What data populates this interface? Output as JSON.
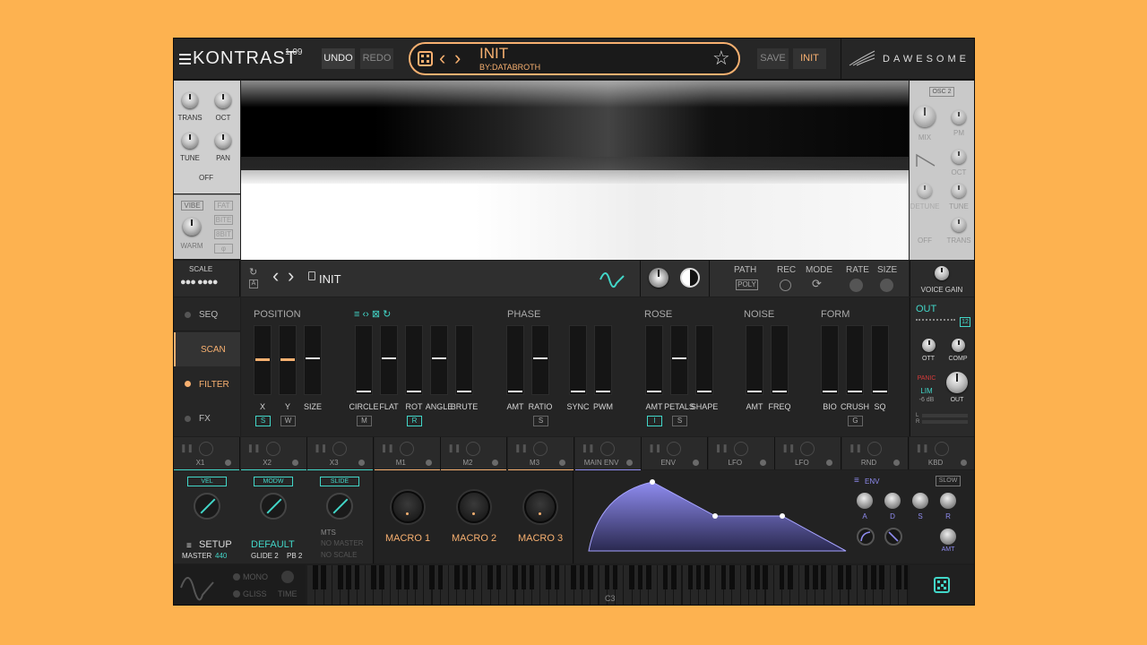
{
  "header": {
    "app_name": "KONTRAST",
    "version": "1.09",
    "undo": "UNDO",
    "redo": "REDO",
    "preset_name": "INIT",
    "preset_author": "BY:DATABROTH",
    "save": "SAVE",
    "init": "INIT",
    "brand": "DAWESOME"
  },
  "osc1": {
    "trans": "TRANS",
    "oct": "OCT",
    "tune": "TUNE",
    "pan": "PAN",
    "off": "OFF",
    "vibe": "VIBE",
    "fat": "FAT",
    "bite": "BITE",
    "bit8": "8BIT",
    "phi": "φ",
    "warm": "WARM"
  },
  "osc2": {
    "title": "OSC 2",
    "mix": "MIX",
    "pm": "PM",
    "oct": "OCT",
    "detune": "DETUNE",
    "tune": "TUNE",
    "off": "OFF",
    "trans": "TRANS"
  },
  "scale": {
    "label": "SCALE"
  },
  "wavebar": {
    "a_tag": "A",
    "table_name": "INIT",
    "path": "PATH",
    "poly": "POLY",
    "rec": "REC",
    "mode": "MODE",
    "rate": "RATE",
    "size": "SIZE",
    "voice_gain": "VOICE GAIN"
  },
  "side_tabs": [
    "SEQ",
    "SCAN",
    "FILTER",
    "FX"
  ],
  "sections": {
    "position": "POSITION",
    "phase": "PHASE",
    "rose": "ROSE",
    "noise": "NOISE",
    "form": "FORM"
  },
  "faders": {
    "position": [
      "X",
      "Y",
      "SIZE"
    ],
    "position_tags": [
      "S",
      "W",
      ""
    ],
    "bend": [
      "CIRCLE",
      "FLAT",
      "ROT",
      "ANGLE",
      "BRUTE"
    ],
    "bend_tags": [
      "",
      "M",
      "",
      "R",
      ""
    ],
    "phase": [
      "AMT",
      "RATIO",
      "SYNC",
      "PWM"
    ],
    "phase_tags": [
      "",
      "S",
      "",
      ""
    ],
    "rose": [
      "AMT",
      "PETALS",
      "SHAPE"
    ],
    "rose_tags": [
      "I",
      "S",
      ""
    ],
    "noise": [
      "AMT",
      "FREQ"
    ],
    "form": [
      "BIO",
      "CRUSH",
      "SQ"
    ],
    "form_tags": [
      "",
      "G",
      ""
    ]
  },
  "out": {
    "title": "OUT",
    "voices": "12",
    "ott": "OTT",
    "comp": "COMP",
    "panic": "PANIC",
    "lim": "LIM",
    "db": "-6 dB",
    "out": "OUT",
    "l": "L",
    "r": "R"
  },
  "mod_slots": [
    "X1",
    "X2",
    "X3",
    "M1",
    "M2",
    "M3",
    "MAIN ENV",
    "ENV",
    "LFO",
    "LFO",
    "RND",
    "KBD"
  ],
  "xpad": {
    "vel": "VEL",
    "modw": "MODW",
    "slide": "SLIDE",
    "setup": "SETUP",
    "master": "MASTER",
    "master_val": "440",
    "default": "DEFAULT",
    "glide": "GLIDE 2",
    "pb": "PB 2",
    "mts": "MTS",
    "no_master": "NO MASTER",
    "no_scale": "NO SCALE"
  },
  "macros": [
    "MACRO 1",
    "MACRO 2",
    "MACRO 3"
  ],
  "env": {
    "title": "ENV",
    "slow": "SLOW",
    "a": "A",
    "d": "D",
    "s": "S",
    "r": "R",
    "amt": "AMT"
  },
  "keyboard": {
    "mono": "MONO",
    "gliss": "GLISS",
    "time": "TIME",
    "c3": "C3"
  },
  "colors": {
    "teal": "#42d6c8",
    "orange": "#f7b070",
    "purple": "#8f8cf0",
    "background": "#FDB250"
  }
}
